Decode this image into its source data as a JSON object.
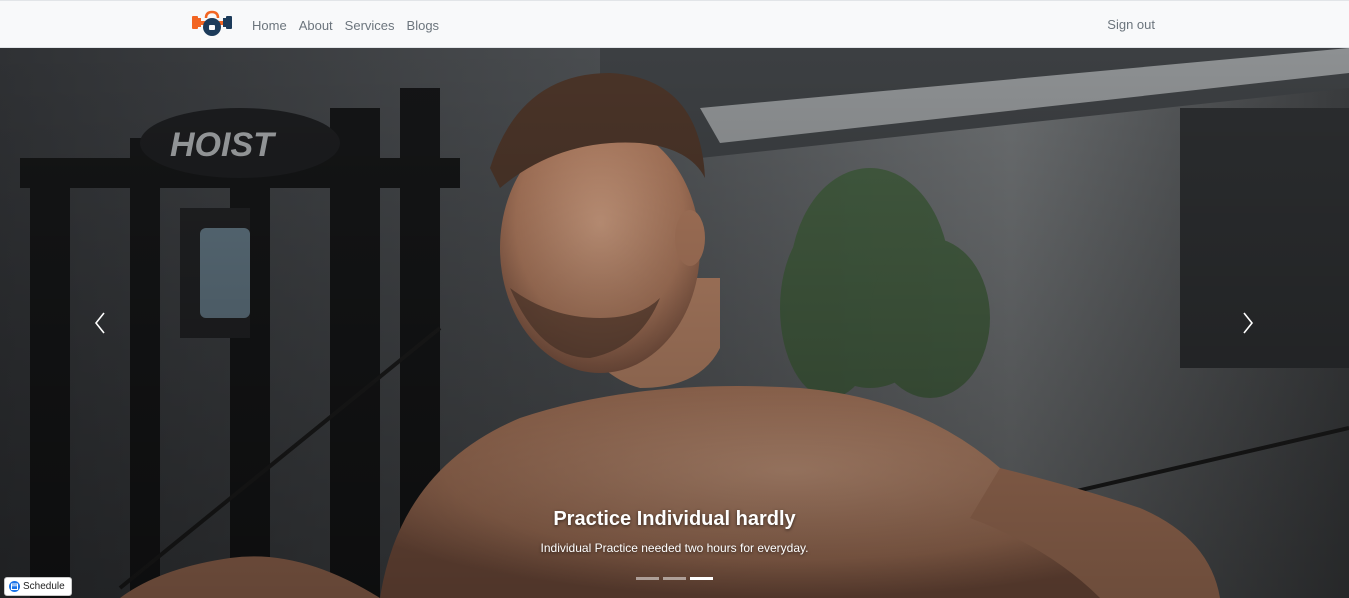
{
  "navbar": {
    "logo_icon": "dumbbell-kettlebell-logo-icon",
    "links": [
      {
        "label": "Home"
      },
      {
        "label": "About"
      },
      {
        "label": "Services"
      },
      {
        "label": "Blogs"
      }
    ],
    "signout_label": "Sign out"
  },
  "hero": {
    "image_icon": "gym-athlete-photo",
    "prev_icon": "chevron-left-icon",
    "next_icon": "chevron-right-icon",
    "caption_title": "Practice Individual hardly",
    "caption_text": "Individual Practice needed two hours for everyday.",
    "slide_count": 3,
    "active_slide": 3
  },
  "schedule": {
    "label": "Schedule",
    "icon": "calendar-icon"
  },
  "colors": {
    "navbar_bg": "#f8f9fa",
    "nav_text": "#6c757d",
    "logo_orange": "#f26522",
    "logo_navy": "#1c3b5a"
  }
}
